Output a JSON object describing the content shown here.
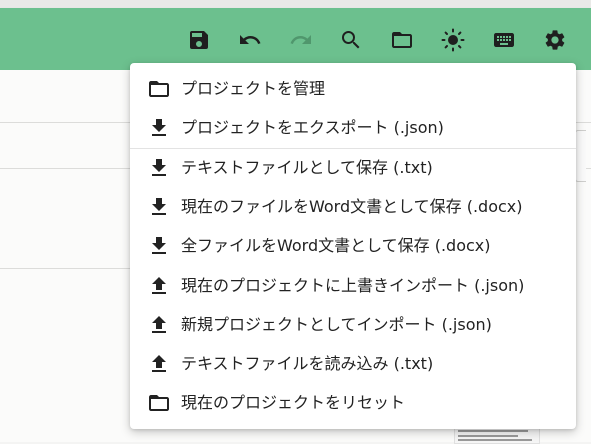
{
  "toolbar": {
    "bg": "#6cc08e",
    "icons": [
      {
        "name": "save-icon",
        "label": "save"
      },
      {
        "name": "undo-icon",
        "label": "undo"
      },
      {
        "name": "redo-icon",
        "label": "redo",
        "disabled": true
      },
      {
        "name": "search-icon",
        "label": "search"
      },
      {
        "name": "folder-icon",
        "label": "folder"
      },
      {
        "name": "brightness-icon",
        "label": "theme"
      },
      {
        "name": "keyboard-icon",
        "label": "keyboard"
      },
      {
        "name": "settings-gear-icon",
        "label": "settings"
      }
    ]
  },
  "menu": {
    "items": [
      {
        "icon": "folder-icon",
        "label": "プロジェクトを管理"
      },
      {
        "icon": "download-icon",
        "label": "プロジェクトをエクスポート (.json)"
      },
      {
        "icon": "download-icon",
        "label": "テキストファイルとして保存 (.txt)"
      },
      {
        "icon": "download-icon",
        "label": "現在のファイルをWord文書として保存 (.docx)"
      },
      {
        "icon": "download-icon",
        "label": "全ファイルをWord文書として保存 (.docx)"
      },
      {
        "icon": "upload-icon",
        "label": "現在のプロジェクトに上書きインポート (.json)"
      },
      {
        "icon": "upload-icon",
        "label": "新規プロジェクトとしてインポート (.json)"
      },
      {
        "icon": "upload-icon",
        "label": "テキストファイルを読み込み (.txt)"
      },
      {
        "icon": "folder-icon",
        "label": "現在のプロジェクトをリセット"
      }
    ]
  }
}
